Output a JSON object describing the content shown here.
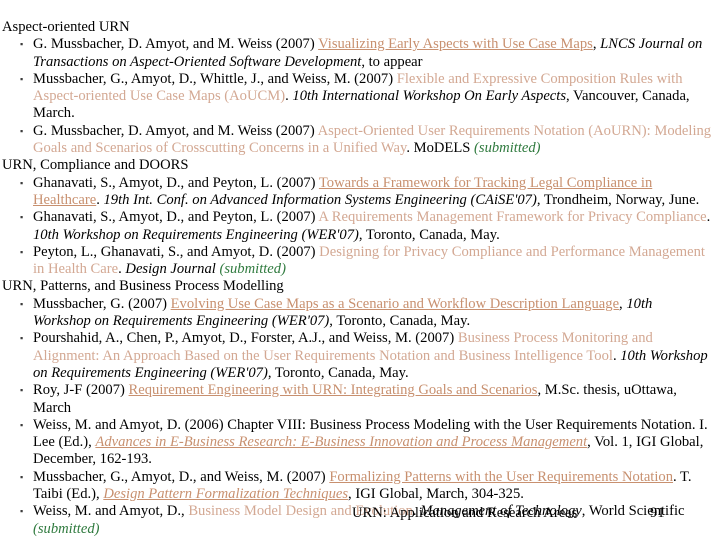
{
  "slide": {
    "bullet_glyph": "▪",
    "colors": {
      "link": "#c8906f",
      "tint": "#d3a893",
      "submitted": "#2f7a3e",
      "text": "#000000",
      "background": "#ffffff"
    }
  },
  "sections": [
    {
      "heading": "Aspect-oriented URN",
      "entries": [
        {
          "parts": [
            {
              "text": "G. Mussbacher, D. Amyot, and M. Weiss (2007) ",
              "style": "plain"
            },
            {
              "text": "Visualizing Early Aspects with Use Case Maps",
              "style": "link"
            },
            {
              "text": ", ",
              "style": "plain"
            },
            {
              "text": "LNCS Journal on Transactions on Aspect-Oriented Software Development",
              "style": "italic"
            },
            {
              "text": ", to appear",
              "style": "plain"
            }
          ]
        },
        {
          "parts": [
            {
              "text": "Mussbacher, G., Amyot, D., Whittle, J., and Weiss, M. (2007) ",
              "style": "plain"
            },
            {
              "text": "Flexible and Expressive Composition Rules with Aspect-oriented Use Case Maps (AoUCM)",
              "style": "tint"
            },
            {
              "text": ". ",
              "style": "plain"
            },
            {
              "text": "10th International Workshop On Early Aspects",
              "style": "italic"
            },
            {
              "text": ", Vancouver, Canada, March.",
              "style": "plain"
            }
          ]
        },
        {
          "parts": [
            {
              "text": "G. Mussbacher, D. Amyot, and M. Weiss (2007) ",
              "style": "plain"
            },
            {
              "text": "Aspect-Oriented User Requirements Notation (AoURN): Modeling Goals and Scenarios of Crosscutting Concerns in a Unified Way",
              "style": "tint"
            },
            {
              "text": ". MoDELS ",
              "style": "plain"
            },
            {
              "text": "(submitted)",
              "style": "submitted"
            }
          ]
        }
      ]
    },
    {
      "heading": "URN, Compliance and DOORS",
      "entries": [
        {
          "parts": [
            {
              "text": "Ghanavati, S., Amyot, D., and Peyton, L. (2007) ",
              "style": "plain"
            },
            {
              "text": "Towards a Framework for Tracking Legal Compliance in Healthcare",
              "style": "link"
            },
            {
              "text": ". ",
              "style": "plain"
            },
            {
              "text": "19th Int. Conf. on Advanced Information Systems Engineering (CAiSE'07)",
              "style": "italic"
            },
            {
              "text": ", Trondheim, Norway, June.",
              "style": "plain"
            }
          ]
        },
        {
          "parts": [
            {
              "text": "Ghanavati, S., Amyot, D., and Peyton, L. (2007) ",
              "style": "plain"
            },
            {
              "text": "A Requirements Management Framework for Privacy Compliance",
              "style": "tint"
            },
            {
              "text": ". ",
              "style": "plain"
            },
            {
              "text": "10th Workshop on Requirements Engineering (WER'07)",
              "style": "italic"
            },
            {
              "text": ", Toronto, Canada, May.",
              "style": "plain"
            }
          ]
        },
        {
          "parts": [
            {
              "text": "Peyton, L., Ghanavati, S., and Amyot, D. (2007) ",
              "style": "plain"
            },
            {
              "text": "Designing for Privacy Compliance and Performance Management in Health Care",
              "style": "tint"
            },
            {
              "text": ". ",
              "style": "plain"
            },
            {
              "text": "Design Journal",
              "style": "italic"
            },
            {
              "text": " ",
              "style": "plain"
            },
            {
              "text": "(submitted)",
              "style": "submitted"
            }
          ]
        }
      ]
    },
    {
      "heading": "URN, Patterns, and Business Process Modelling",
      "entries": [
        {
          "parts": [
            {
              "text": "Mussbacher, G. (2007) ",
              "style": "plain"
            },
            {
              "text": "Evolving Use Case Maps as a Scenario and Workflow Description Language",
              "style": "link"
            },
            {
              "text": ", ",
              "style": "plain"
            },
            {
              "text": "10th Workshop on Requirements Engineering (WER'07)",
              "style": "italic"
            },
            {
              "text": ", Toronto, Canada, May.",
              "style": "plain"
            }
          ]
        },
        {
          "parts": [
            {
              "text": "Pourshahid, A., Chen, P., Amyot, D., Forster, A.J., and Weiss, M. (2007) ",
              "style": "plain"
            },
            {
              "text": "Business Process Monitoring and Alignment: An Approach Based on the User Requirements Notation and Business Intelligence Tool",
              "style": "tint"
            },
            {
              "text": ". ",
              "style": "plain"
            },
            {
              "text": "10th Workshop on Requirements Engineering (WER'07)",
              "style": "italic"
            },
            {
              "text": ", Toronto, Canada, May.",
              "style": "plain"
            }
          ]
        },
        {
          "parts": [
            {
              "text": "Roy, J-F (2007) ",
              "style": "plain"
            },
            {
              "text": "Requirement Engineering with URN: Integrating Goals and Scenarios",
              "style": "link"
            },
            {
              "text": ", M.Sc. thesis, uOttawa, March",
              "style": "plain"
            }
          ]
        },
        {
          "parts": [
            {
              "text": "Weiss, M. and Amyot, D. (2006) Chapter VIII: Business Process Modeling with the User Requirements Notation. I. Lee (Ed.), ",
              "style": "plain"
            },
            {
              "text": "Advances in E-Business Research: E-Business Innovation and Process Management",
              "style": "link-italic"
            },
            {
              "text": ", Vol. 1, IGI Global, December, 162-193.",
              "style": "plain"
            }
          ]
        },
        {
          "parts": [
            {
              "text": "Mussbacher, G., Amyot, D., and Weiss, M. (2007) ",
              "style": "plain"
            },
            {
              "text": "Formalizing Patterns with the User Requirements Notation",
              "style": "link"
            },
            {
              "text": ". T. Taibi (Ed.), ",
              "style": "plain"
            },
            {
              "text": "Design Pattern Formalization Techniques",
              "style": "link-italic"
            },
            {
              "text": ", IGI Global, March, 304-325.",
              "style": "plain"
            }
          ]
        },
        {
          "parts": [
            {
              "text": "Weiss, M. and Amyot, D., ",
              "style": "plain"
            },
            {
              "text": "Business Model Design and Evolution",
              "style": "tint"
            },
            {
              "text": ". ",
              "style": "plain"
            },
            {
              "text": "Management of Technology",
              "style": "italic"
            },
            {
              "text": ", World Scientific ",
              "style": "plain"
            },
            {
              "text": "(submitted)",
              "style": "submitted"
            }
          ]
        }
      ]
    }
  ],
  "footer": {
    "title": "URN: Application and Research Areas",
    "page_number": "91"
  }
}
